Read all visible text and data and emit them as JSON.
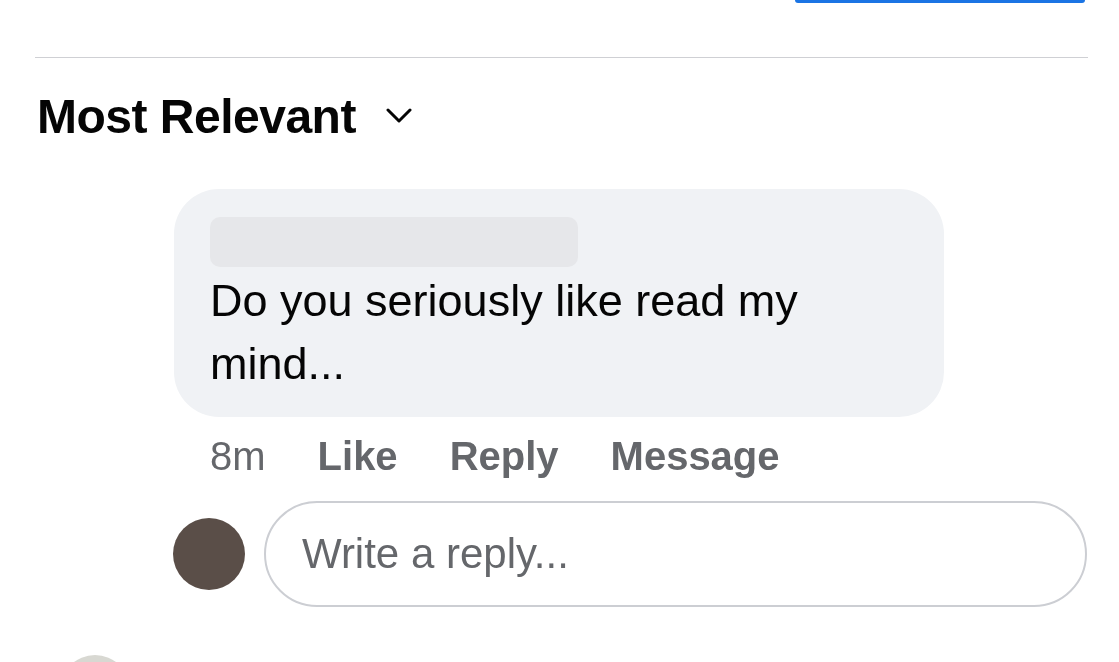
{
  "sort": {
    "label": "Most Relevant"
  },
  "comment": {
    "text": "Do you seriously like read my mind...",
    "actions": [
      {
        "kind": "timestamp",
        "label": "8m"
      },
      {
        "kind": "action",
        "label": "Like"
      },
      {
        "kind": "action",
        "label": "Reply"
      },
      {
        "kind": "action",
        "label": "Message"
      }
    ]
  },
  "reply": {
    "placeholder": "Write a reply..."
  }
}
